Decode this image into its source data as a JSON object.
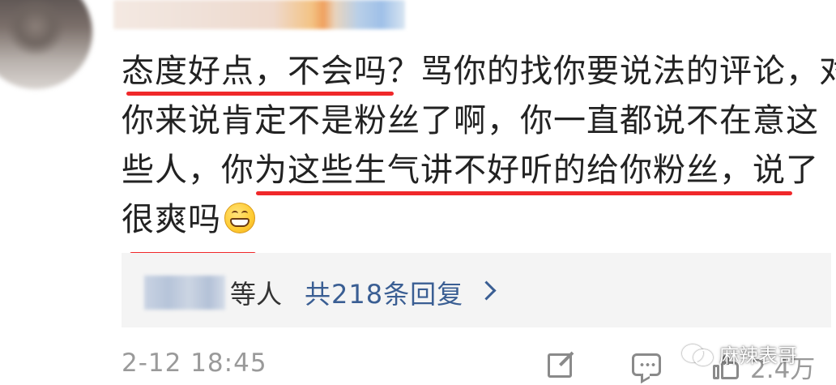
{
  "comment": {
    "lines": [
      "态度好点，不会吗？骂你的找你要说法的评论，对",
      "你来说肯定不是粉丝了啊，你一直都说不在意这",
      "些人，你为这些生气讲不好听的给你粉丝，说了",
      "很爽吗"
    ],
    "emoji": "grinning-face-icon",
    "underline_color": "#f0282a"
  },
  "replies": {
    "suffix": "等人",
    "count_label": "共218条回复"
  },
  "meta": {
    "date": "2-12 18:45",
    "likes": "2.4万"
  },
  "watermark": {
    "text": "麻辣表哥"
  },
  "colors": {
    "link": "#3a5e93",
    "muted": "#9a9a9a",
    "text": "#222222",
    "reply_bg": "#f4f4f4"
  }
}
